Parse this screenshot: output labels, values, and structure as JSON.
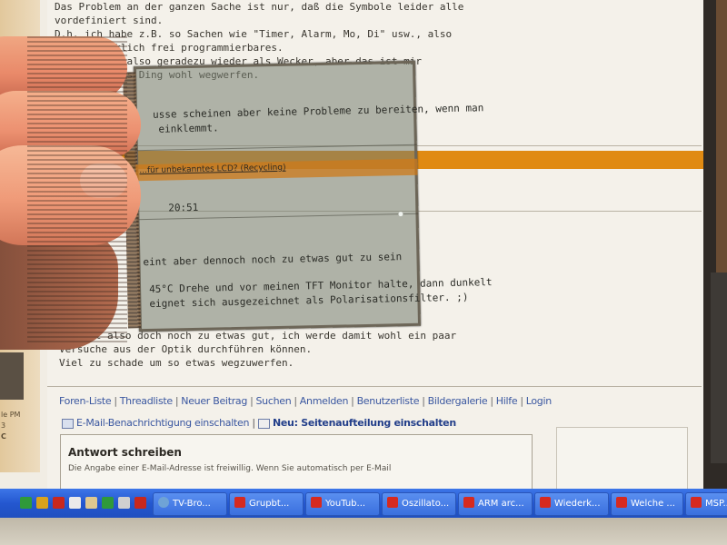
{
  "forum": {
    "post1_lines": [
      "Das Problem an der ganzen Sache ist nur, daß die Symbole leider alle",
      "vordefiniert sind.",
      "D.h. ich habe z.B. so Sachen wie \"Timer, Alarm, Mo, Di\" usw., also",
      "nichts wirklich frei programmierbares.",
      "eignet sich also geradezu wieder als Wecker, aber das ist mir",
      "Ich werde das Ding wohl wegwerfen.",
      "",
      "usse scheinen aber keine Probleme zu bereiten, wenn man",
      "einklemmt."
    ],
    "post2_lines": [
      "eint aber dennoch noch zu etwas gut zu sein",
      "",
      "45°C Drehe und vor meinen TFT Monitor halte, dann dunkelt",
      "eignet sich ausgezeichnet als Polarisationsfilter. ;)"
    ],
    "post2b_lines": [
      "... ist also doch noch zu etwas gut, ich werde damit wohl ein paar",
      "Versuche aus der Optik durchführen können.",
      "Viel zu schade um so etwas wegzuwerfen."
    ],
    "left_small_1": "le PM",
    "left_small_2": "3",
    "left_small_3": "C",
    "footer_links": [
      "Foren-Liste",
      "Threadliste",
      "Neuer Beitrag",
      "Suchen",
      "Anmelden",
      "Benutzerliste",
      "Bildergalerie",
      "Hilfe",
      "Login"
    ],
    "notify_mail": "E-Mail-Benachrichtigung einschalten",
    "notify_sep": "|",
    "notify_split": "Neu: Seitenaufteilung einschalten",
    "answer_title": "Antwort schreiben",
    "answer_sub": "Die Angabe einer E-Mail-Adresse ist freiwillig. Wenn Sie automatisch per E-Mail"
  },
  "lcd": {
    "thread_title": "...für unbekanntes LCD? (Recycling)",
    "time": "20:51"
  },
  "taskbar": {
    "buttons": [
      {
        "label": "TV-Bro...",
        "icon": "globe-icon"
      },
      {
        "label": "Grupbt...",
        "icon": "opera-icon"
      },
      {
        "label": "YouTub...",
        "icon": "opera-icon"
      },
      {
        "label": "Oszillato...",
        "icon": "opera-icon"
      },
      {
        "label": "ARM arc...",
        "icon": "opera-icon"
      },
      {
        "label": "Wiederk...",
        "icon": "opera-icon"
      },
      {
        "label": "Welche ...",
        "icon": "opera-icon"
      },
      {
        "label": "MSP...",
        "icon": "opera-icon"
      }
    ],
    "quicklaunch_colors": [
      "#2f9a3a",
      "#d9a21c",
      "#c8281e",
      "#eaeaea",
      "#e0c890",
      "#2f9a3a",
      "#d0d0d0",
      "#c8281e"
    ]
  }
}
